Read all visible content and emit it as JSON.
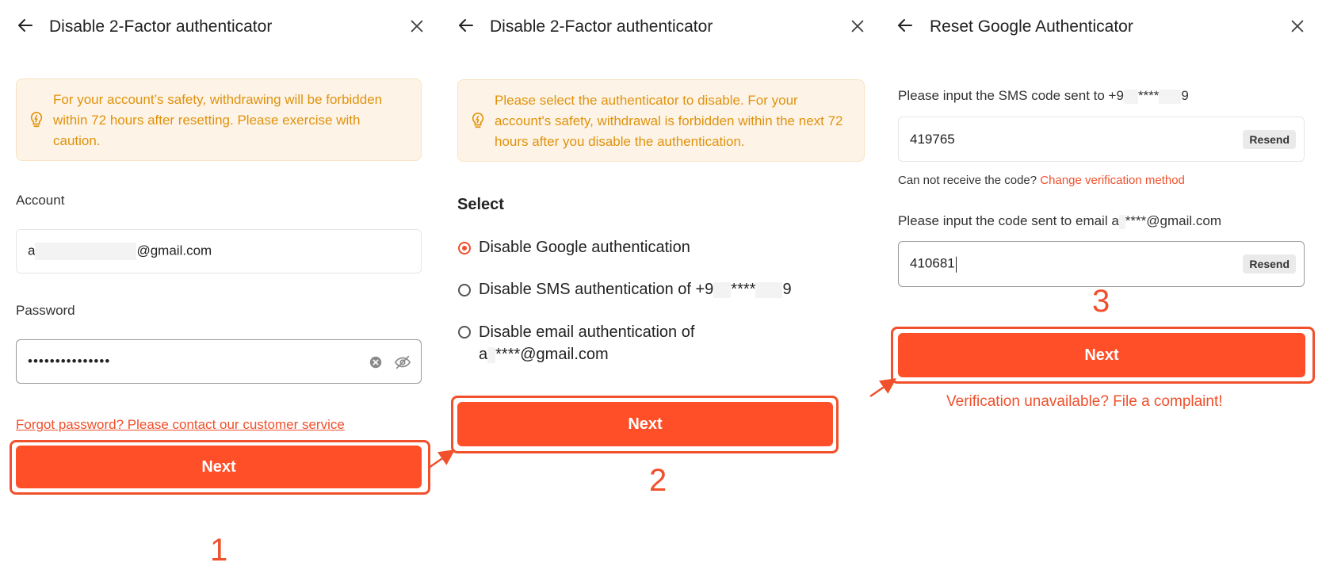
{
  "panel1": {
    "title": "Disable 2-Factor authenticator",
    "notice": "For your account’s safety, withdrawing will be forbidden within 72 hours after resetting. Please exercise with caution.",
    "account_label": "Account",
    "account_prefix": "a",
    "account_suffix": "@gmail.com",
    "password_label": "Password",
    "password_value": "•••••••••••••••",
    "forgot_link": "Forgot password? Please contact our customer service",
    "next_label": "Next",
    "step": "1"
  },
  "panel2": {
    "title": "Disable 2-Factor authenticator",
    "notice": "Please select the authenticator to disable. For your account's safety, withdrawal is forbidden within the next 72 hours after you disable the authentication.",
    "select_label": "Select",
    "options": [
      {
        "label": "Disable Google authentication",
        "selected": true
      },
      {
        "label_a": "Disable SMS authentication of +9",
        "label_b": "****",
        "label_c": "9",
        "selected": false
      },
      {
        "line1": "Disable email authentication of",
        "line2_a": "a",
        "line2_b": "****@gmail.com",
        "selected": false
      }
    ],
    "next_label": "Next",
    "step": "2"
  },
  "panel3": {
    "title": "Reset Google Authenticator",
    "sms_label_a": "Please input the SMS code sent to +9",
    "sms_label_b": "****",
    "sms_label_c": "9",
    "sms_code": "419765",
    "resend_label": "Resend",
    "no_code_text": "Can not receive the code?",
    "change_method_link": "Change verification method",
    "email_label_a": "Please input the code sent to email a",
    "email_label_b": "****@gmail.com",
    "email_code": "410681",
    "next_label": "Next",
    "complaint_link": "Verification unavailable? File a complaint!",
    "step": "3"
  },
  "colors": {
    "accent": "#fe4f29",
    "highlight": "#f0502c",
    "notice_bg": "#fdf4e7",
    "notice_text": "#e0920e"
  }
}
